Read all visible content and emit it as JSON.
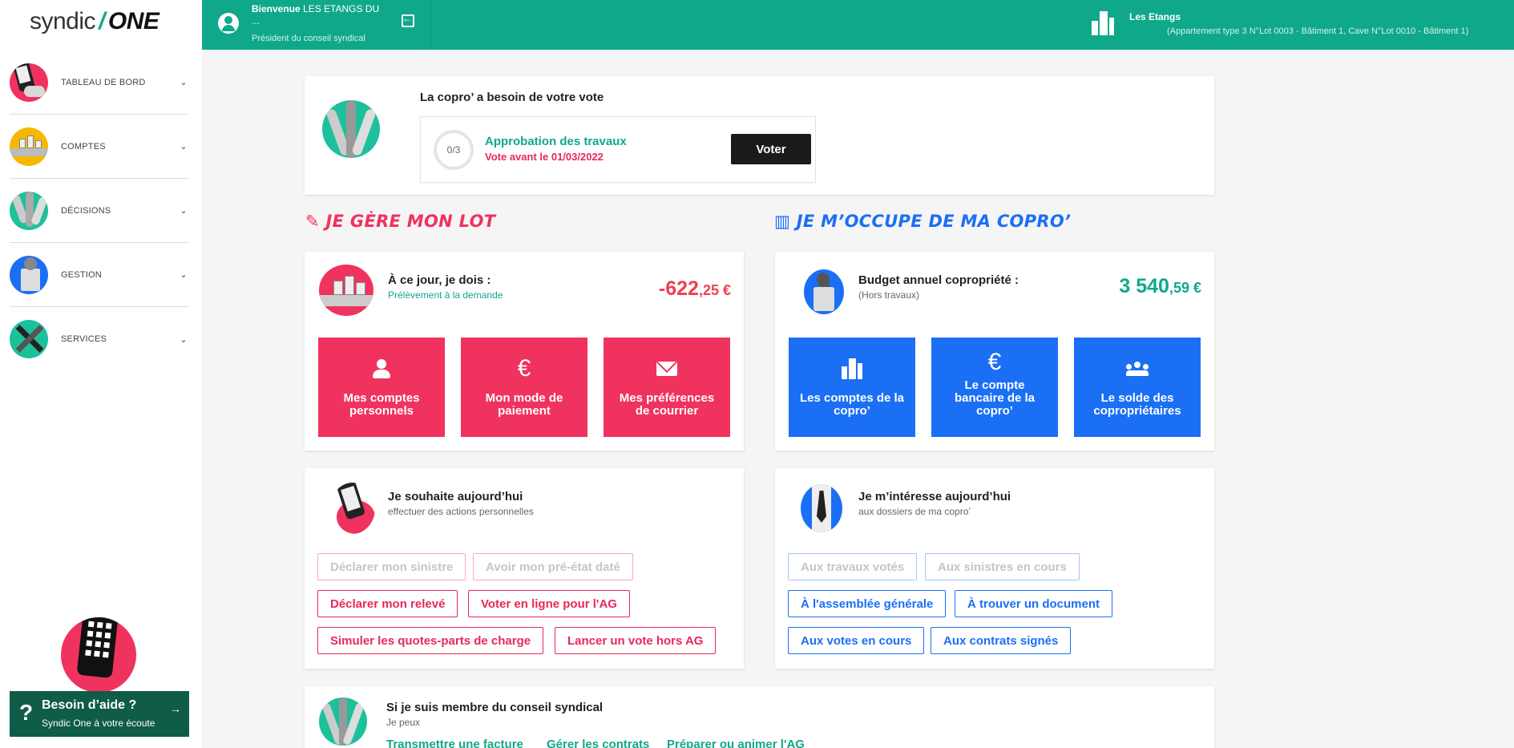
{
  "app": {
    "logo_left": "syndic",
    "logo_slash": "/",
    "logo_right": "ONE"
  },
  "sidebar": {
    "items": [
      {
        "label": "TABLEAU DE BORD"
      },
      {
        "label": "COMPTES"
      },
      {
        "label": "DÉCISIONS"
      },
      {
        "label": "GESTION"
      },
      {
        "label": "SERVICES"
      }
    ],
    "chevron": "⌄",
    "help": {
      "question_mark": "?",
      "title": "Besoin d’aide ?",
      "subtitle": "Syndic One à votre écoute",
      "arrow": "→"
    }
  },
  "header": {
    "welcome_bold": "Bienvenue",
    "welcome_name": "LES ETANGS DU ...",
    "role": "Président du conseil syndical",
    "lot_title": "Les Etangs",
    "lot_desc": "(Appartement type 3 N°Lot 0003 - Bâtiment 1, Cave N°Lot 0010 - Bâtiment 1)"
  },
  "vote_card": {
    "title": "La copro’ a besoin de votre vote",
    "progress": "0/3",
    "item_name": "Approbation des travaux",
    "deadline": "Vote avant le 01/03/2022",
    "button": "Voter"
  },
  "lot_section": {
    "title": "JE GÈRE MON LOT",
    "balance_title": "À ce jour, je dois :",
    "balance_sub": "Prélèvement à la demande",
    "amount_int": "-622",
    "amount_dec": ",25 €",
    "tiles": [
      {
        "label": "Mes comptes personnels",
        "icon": "user-icon"
      },
      {
        "label": "Mon mode de paiement",
        "icon": "euro-icon"
      },
      {
        "label": "Mes préférences de courrier",
        "icon": "envelope-icon"
      }
    ],
    "actions_title": "Je souhaite aujourd’hui",
    "actions_sub": "effectuer des actions personnelles",
    "chips": [
      {
        "label": "Déclarer mon sinistre",
        "enabled": false
      },
      {
        "label": "Avoir mon pré-état daté",
        "enabled": false
      },
      {
        "label": "Déclarer mon relevé",
        "enabled": true
      },
      {
        "label": "Voter en ligne pour l'AG",
        "enabled": true
      },
      {
        "label": "Simuler les quotes-parts de charge",
        "enabled": true
      },
      {
        "label": "Lancer un vote hors AG",
        "enabled": true
      }
    ]
  },
  "copro_section": {
    "title": "JE M’OCCUPE DE MA COPRO’",
    "budget_title": "Budget annuel copropriété :",
    "budget_sub": "(Hors travaux)",
    "amount_int": "3 540",
    "amount_dec": ",59 €",
    "tiles": [
      {
        "label": "Les comptes de la copro’",
        "icon": "building-icon"
      },
      {
        "label": "Le compte bancaire de la copro’",
        "icon": "euro-icon"
      },
      {
        "label": "Le solde des copropriétaires",
        "icon": "group-icon"
      }
    ],
    "interest_title": "Je m’intéresse aujourd’hui",
    "interest_sub": "aux dossiers de ma copro’",
    "chips": [
      {
        "label": "Aux travaux votés",
        "enabled": false
      },
      {
        "label": "Aux sinistres en cours",
        "enabled": false
      },
      {
        "label": "À l'assemblée générale",
        "enabled": true
      },
      {
        "label": "À trouver un document",
        "enabled": true
      },
      {
        "label": "Aux votes en cours",
        "enabled": true
      },
      {
        "label": "Aux contrats signés",
        "enabled": true
      }
    ]
  },
  "council_card": {
    "title": "Si je suis membre du conseil syndical",
    "sub": "Je peux",
    "links": [
      "Transmettre une facture",
      "Gérer les contrats",
      "Préparer ou animer l'AG"
    ]
  },
  "colors": {
    "green": "#10a88b",
    "pink": "#f0325f",
    "blue": "#1b6ff5",
    "dark_green": "#0f5c48"
  }
}
